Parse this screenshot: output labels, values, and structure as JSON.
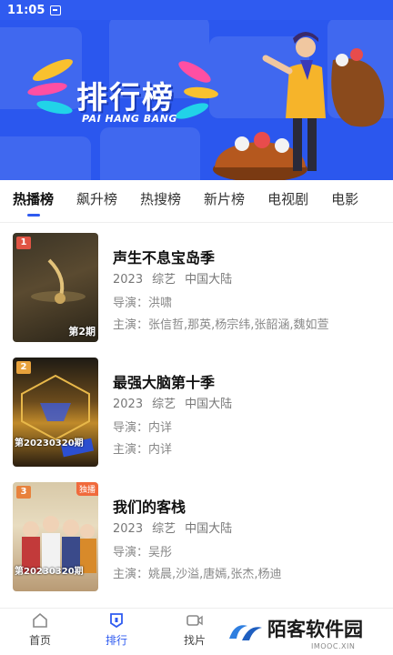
{
  "status_bar": {
    "time": "11:05"
  },
  "banner": {
    "title": "排行榜",
    "subtitle": "PAI HANG BANG"
  },
  "tabs": [
    {
      "label": "热播榜",
      "active": true
    },
    {
      "label": "飙升榜"
    },
    {
      "label": "热搜榜"
    },
    {
      "label": "新片榜"
    },
    {
      "label": "电视剧"
    },
    {
      "label": "电影"
    }
  ],
  "items": [
    {
      "rank": "1",
      "title": "声生不息宝岛季",
      "year": "2023",
      "genre": "综艺",
      "region": "中国大陆",
      "director": "导演：洪啸",
      "cast": "主演：张信哲,那英,杨宗纬,张韶涵,魏如萱",
      "episode": "第2期"
    },
    {
      "rank": "2",
      "title": "最强大脑第十季",
      "year": "2023",
      "genre": "综艺",
      "region": "中国大陆",
      "director": "导演：内详",
      "cast": "主演：内详",
      "episode": "第20230320期"
    },
    {
      "rank": "3",
      "title": "我们的客栈",
      "year": "2023",
      "genre": "综艺",
      "region": "中国大陆",
      "director": "导演：吴彤",
      "cast": "主演：姚晨,沙溢,唐嫣,张杰,杨迪",
      "episode": "第20230320期",
      "badge": "独播"
    }
  ],
  "bottom_nav": [
    {
      "label": "首页",
      "icon": "home-icon"
    },
    {
      "label": "排行",
      "icon": "ranking-icon",
      "active": true
    },
    {
      "label": "找片",
      "icon": "video-icon"
    }
  ],
  "watermark": {
    "text": "陌客软件园",
    "sub": "IMOOC.XIN"
  },
  "colors": {
    "accent": "#2f5bf0",
    "banner": "#2b57ee"
  }
}
